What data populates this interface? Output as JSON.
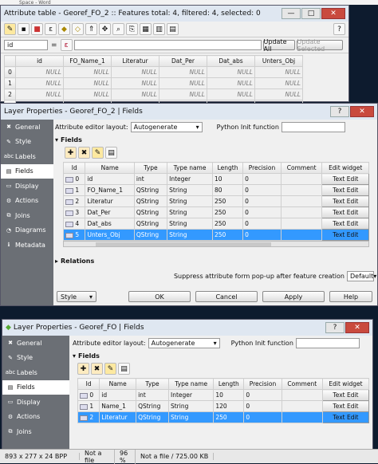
{
  "bg_title": "Space - Word",
  "attr": {
    "title": "Attribute table - Georef_FO_2 :: Features total: 4, filtered: 4, selected: 0",
    "field_value": "id",
    "expr_icon": "ε",
    "update_all": "Update All",
    "update_selected": "Update Selected",
    "headers": [
      "id",
      "FO_Name_1",
      "Literatur",
      "Dat_Per",
      "Dat_abs",
      "Unters_Obj"
    ],
    "rows": [
      {
        "n": "0",
        "cells": [
          "NULL",
          "NULL",
          "NULL",
          "NULL",
          "NULL",
          "NULL"
        ]
      },
      {
        "n": "1",
        "cells": [
          "NULL",
          "NULL",
          "NULL",
          "NULL",
          "NULL",
          "NULL"
        ]
      },
      {
        "n": "2",
        "cells": [
          "NULL",
          "NULL",
          "NULL",
          "NULL",
          "NULL",
          "NULL"
        ]
      },
      {
        "n": "3",
        "cells": [
          "NULL",
          "NULL",
          "NULL",
          "NULL",
          "NULL",
          "NULL"
        ]
      }
    ]
  },
  "lp1": {
    "title": "Layer Properties - Georef_FO_2 | Fields",
    "sidebar": [
      "General",
      "Style",
      "Labels",
      "Fields",
      "Display",
      "Actions",
      "Joins",
      "Diagrams",
      "Metadata"
    ],
    "sidebar_icons": [
      "tools-icon",
      "brush-icon",
      "labels-icon",
      "fields-icon",
      "display-icon",
      "actions-icon",
      "joins-icon",
      "diagrams-icon",
      "metadata-icon"
    ],
    "selected": 3,
    "editor_label": "Attribute editor layout:",
    "editor_value": "Autogenerate",
    "python_label": "Python Init function",
    "fields_label": "Fields",
    "headers": [
      "Id",
      "Name",
      "Type",
      "Type name",
      "Length",
      "Precision",
      "Comment",
      "Edit widget"
    ],
    "rows": [
      [
        "0",
        "id",
        "int",
        "Integer",
        "10",
        "0",
        "",
        "Text Edit"
      ],
      [
        "1",
        "FO_Name_1",
        "QString",
        "String",
        "80",
        "0",
        "",
        "Text Edit"
      ],
      [
        "2",
        "Literatur",
        "QString",
        "String",
        "250",
        "0",
        "",
        "Text Edit"
      ],
      [
        "3",
        "Dat_Per",
        "QString",
        "String",
        "250",
        "0",
        "",
        "Text Edit"
      ],
      [
        "4",
        "Dat_abs",
        "QString",
        "String",
        "250",
        "0",
        "",
        "Text Edit"
      ],
      [
        "5",
        "Unters_Obj",
        "QString",
        "String",
        "250",
        "0",
        "",
        "Text Edit"
      ]
    ],
    "selected_row": 5,
    "relations_label": "Relations",
    "suppress_label": "Suppress attribute form pop-up after feature creation",
    "suppress_value": "Default",
    "style_btn": "Style",
    "ok": "OK",
    "cancel": "Cancel",
    "apply": "Apply",
    "help": "Help"
  },
  "lp2": {
    "title": "Layer Properties - Georef_FO | Fields",
    "sidebar": [
      "General",
      "Style",
      "Labels",
      "Fields",
      "Display",
      "Actions",
      "Joins"
    ],
    "sidebar_icons": [
      "tools-icon",
      "brush-icon",
      "labels-icon",
      "fields-icon",
      "display-icon",
      "actions-icon",
      "joins-icon"
    ],
    "selected": 3,
    "editor_label": "Attribute editor layout:",
    "editor_value": "Autogenerate",
    "python_label": "Python Init function",
    "fields_label": "Fields",
    "headers": [
      "Id",
      "Name",
      "Type",
      "Type name",
      "Length",
      "Precision",
      "Comment",
      "Edit widget"
    ],
    "rows": [
      [
        "0",
        "id",
        "int",
        "Integer",
        "10",
        "0",
        "",
        "Text Edit"
      ],
      [
        "1",
        "Name_1",
        "QString",
        "String",
        "120",
        "0",
        "",
        "Text Edit"
      ],
      [
        "2",
        "Literatur",
        "QString",
        "String",
        "250",
        "0",
        "",
        "Text Edit"
      ]
    ],
    "selected_row": 2
  },
  "status": [
    "893 x 277 x 24 BPP",
    "Not a file",
    "96 %",
    "Not a file / 725.00 KB"
  ]
}
